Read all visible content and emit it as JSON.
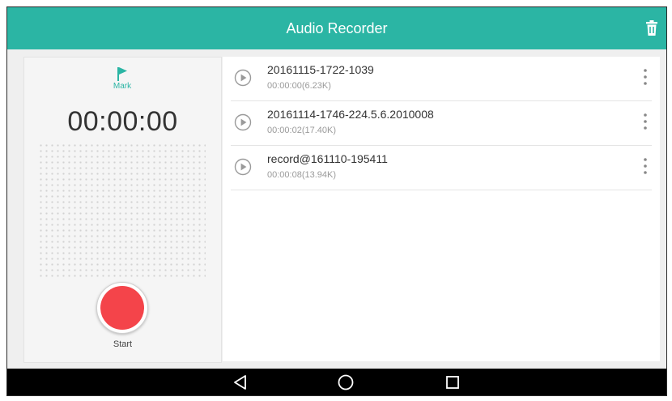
{
  "header": {
    "title": "Audio Recorder",
    "accent_color": "#2bb5a4",
    "delete_icon": "trash-icon"
  },
  "recorder": {
    "mark_label": "Mark",
    "mark_icon": "flag-icon",
    "timer": "00:00:00",
    "start_label": "Start",
    "record_button_color": "#f4444a"
  },
  "recordings": [
    {
      "name": "20161115-1722-1039",
      "meta": "00:00:00(6.23K)"
    },
    {
      "name": "20161114-1746-224.5.6.2010008",
      "meta": "00:00:02(17.40K)"
    },
    {
      "name": "record@161110-195411",
      "meta": "00:00:08(13.94K)"
    }
  ],
  "navbar": {
    "back_icon": "back-triangle-icon",
    "home_icon": "home-circle-icon",
    "recents_icon": "recents-square-icon"
  }
}
